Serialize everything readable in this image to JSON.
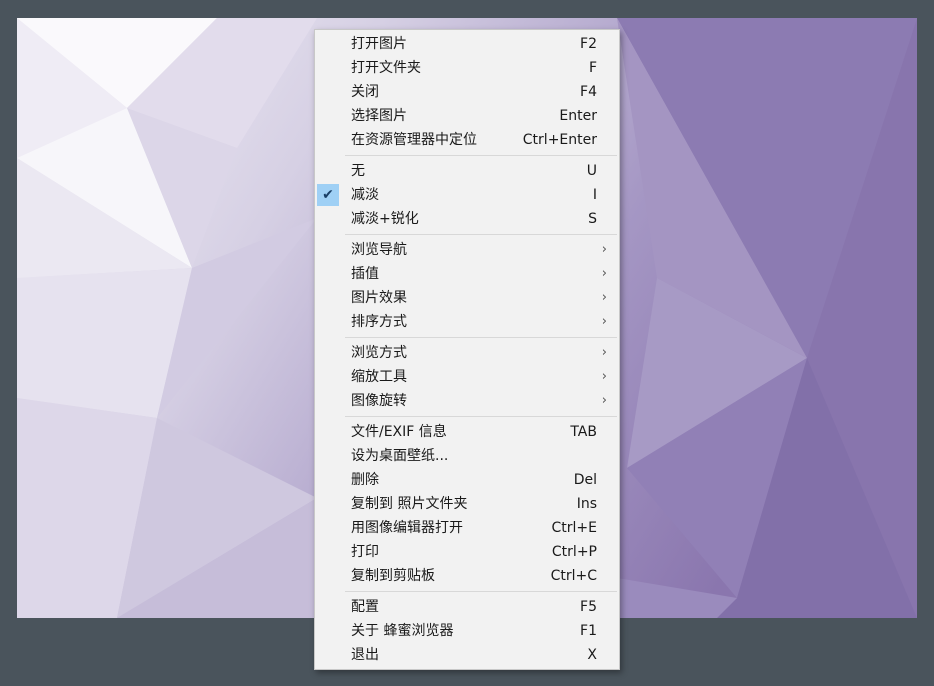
{
  "menu": {
    "groups": [
      [
        {
          "label": "打开图片",
          "shortcut": "F2"
        },
        {
          "label": "打开文件夹",
          "shortcut": "F"
        },
        {
          "label": "关闭",
          "shortcut": "F4"
        },
        {
          "label": "选择图片",
          "shortcut": "Enter"
        },
        {
          "label": "在资源管理器中定位",
          "shortcut": "Ctrl+Enter"
        }
      ],
      [
        {
          "label": "无",
          "shortcut": "U"
        },
        {
          "label": "减淡",
          "shortcut": "I",
          "checked": true,
          "check_icon": "checkmark-icon"
        },
        {
          "label": "减淡+锐化",
          "shortcut": "S"
        }
      ],
      [
        {
          "label": "浏览导航",
          "submenu": true
        },
        {
          "label": "插值",
          "submenu": true
        },
        {
          "label": "图片效果",
          "submenu": true
        },
        {
          "label": "排序方式",
          "submenu": true
        }
      ],
      [
        {
          "label": "浏览方式",
          "submenu": true
        },
        {
          "label": "缩放工具",
          "submenu": true
        },
        {
          "label": "图像旋转",
          "submenu": true
        }
      ],
      [
        {
          "label": "文件/EXIF 信息",
          "shortcut": "TAB"
        },
        {
          "label": "设为桌面壁纸...",
          "shortcut": ""
        },
        {
          "label": "删除",
          "shortcut": "Del"
        },
        {
          "label": "复制到 照片文件夹",
          "shortcut": "Ins"
        },
        {
          "label": "用图像编辑器打开",
          "shortcut": "Ctrl+E"
        },
        {
          "label": "打印",
          "shortcut": "Ctrl+P"
        },
        {
          "label": "复制到剪贴板",
          "shortcut": "Ctrl+C"
        }
      ],
      [
        {
          "label": "配置",
          "shortcut": "F5"
        },
        {
          "label": "关于 蜂蜜浏览器",
          "shortcut": "F1"
        },
        {
          "label": "退出",
          "shortcut": "X"
        }
      ]
    ],
    "submenu_arrow": "›",
    "check_glyph": "✔"
  },
  "colors": {
    "background": "#4a545c",
    "menu_bg": "#f2f2f2",
    "check_highlight": "#9fd0f5",
    "wallpaper_light": "#f4f2f8",
    "wallpaper_dark": "#8a76ae"
  }
}
